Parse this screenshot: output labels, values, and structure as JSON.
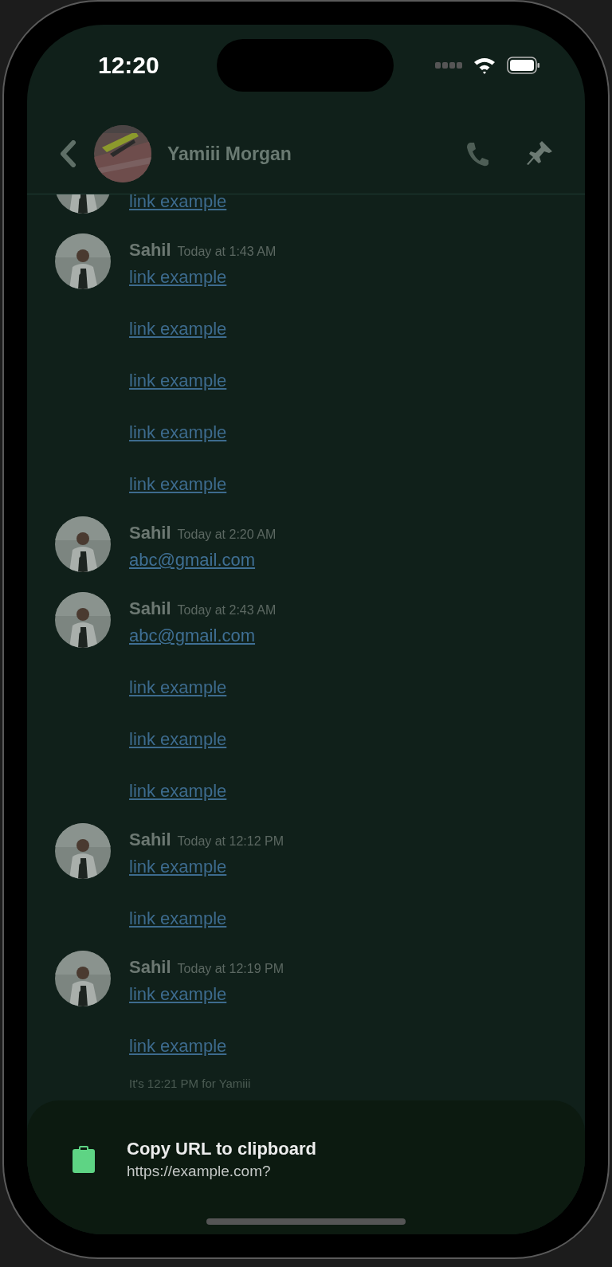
{
  "status_bar": {
    "time": "12:20"
  },
  "header": {
    "name": "Yamiii Morgan"
  },
  "messages": [
    {
      "items": [
        {
          "kind": "link",
          "text": "link example"
        }
      ]
    },
    {
      "author": "Sahil",
      "time": "Today at 1:43 AM",
      "items": [
        {
          "kind": "link",
          "text": "link example"
        },
        {
          "kind": "link",
          "text": "link example"
        },
        {
          "kind": "link",
          "text": "link example"
        },
        {
          "kind": "link",
          "text": "link example"
        },
        {
          "kind": "link",
          "text": "link example"
        }
      ]
    },
    {
      "author": "Sahil",
      "time": "Today at 2:20 AM",
      "items": [
        {
          "kind": "email",
          "text": "abc@gmail.com"
        }
      ]
    },
    {
      "author": "Sahil",
      "time": "Today at 2:43 AM",
      "items": [
        {
          "kind": "email",
          "text": "abc@gmail.com"
        },
        {
          "kind": "link",
          "text": "link example"
        },
        {
          "kind": "link",
          "text": "link example"
        },
        {
          "kind": "link",
          "text": "link example"
        }
      ]
    },
    {
      "author": "Sahil",
      "time": "Today at 12:12 PM",
      "items": [
        {
          "kind": "link",
          "text": "link example"
        },
        {
          "kind": "link",
          "text": "link example"
        }
      ]
    },
    {
      "author": "Sahil",
      "time": "Today at 12:19 PM",
      "items": [
        {
          "kind": "link",
          "text": "link example"
        },
        {
          "kind": "link",
          "text": "link example"
        }
      ]
    }
  ],
  "local_time_note": "It's 12:21 PM for Yamiii",
  "sheet": {
    "title": "Copy URL to clipboard",
    "url": "https://example.com?"
  }
}
